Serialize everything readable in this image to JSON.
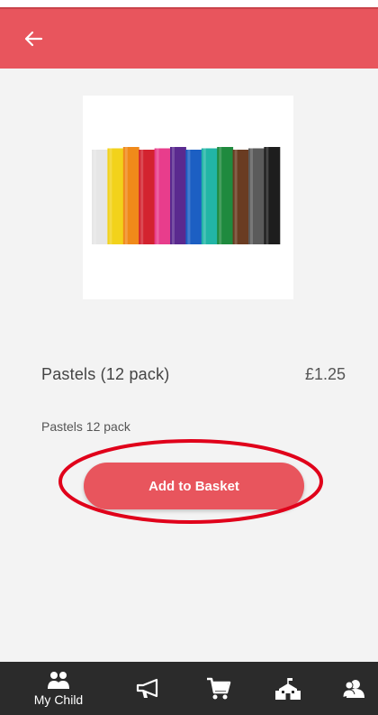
{
  "header": {
    "back_icon": "arrow-left-icon",
    "color": "#e8555d"
  },
  "product": {
    "title": "Pastels (12 pack)",
    "price": "£1.25",
    "description": "Pastels 12 pack",
    "image_icon": "pastels-image",
    "pastel_colors": [
      "#e6e6e6",
      "#f2d21b",
      "#f08a1a",
      "#d3232f",
      "#e83d8c",
      "#5a2a8f",
      "#1c5fc3",
      "#22b5a6",
      "#1f8a3e",
      "#6a3c22",
      "#5b5b5b",
      "#1d1d1d"
    ]
  },
  "actions": {
    "add_to_basket_label": "Add to Basket",
    "button_color": "#e8555d",
    "highlight_color": "#e0001a"
  },
  "bottom_nav": {
    "items": [
      {
        "icon": "my-child-icon",
        "label": "My Child"
      },
      {
        "icon": "megaphone-icon",
        "label": ""
      },
      {
        "icon": "cart-icon",
        "label": ""
      },
      {
        "icon": "school-icon",
        "label": ""
      },
      {
        "icon": "contacts-icon",
        "label": ""
      }
    ]
  }
}
